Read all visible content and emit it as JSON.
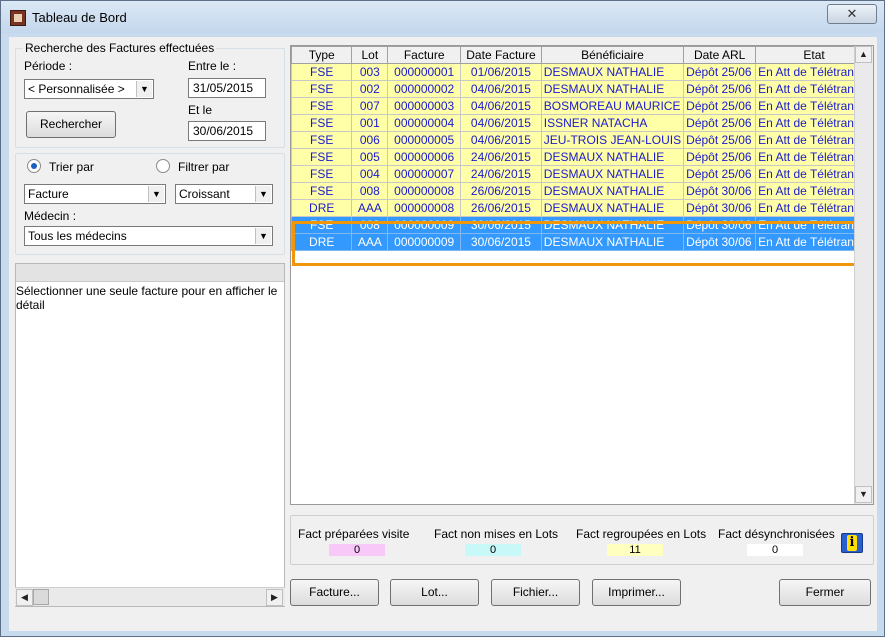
{
  "window": {
    "title": "Tableau de Bord",
    "close_glyph": "✕"
  },
  "search": {
    "group_title": "Recherche des Factures effectuées",
    "period_label": "Période :",
    "period_value": "< Personnalisée >",
    "from_label": "Entre le :",
    "from_value": "31/05/2015",
    "to_label": "Et le",
    "to_value": "30/06/2015",
    "search_button": "Rechercher"
  },
  "sort": {
    "sort_label": "Trier par",
    "filter_label": "Filtrer par",
    "sort_field": "Facture",
    "sort_order": "Croissant",
    "doctor_label": "Médecin :",
    "doctor_value": "Tous les médecins"
  },
  "detail": {
    "message": "Sélectionner une seule  facture pour en afficher le détail"
  },
  "grid": {
    "columns": [
      "Type",
      "Lot",
      "Facture",
      "Date Facture",
      "Bénéficiaire",
      "Date ARL",
      "Etat"
    ],
    "rows": [
      [
        "FSE",
        "003",
        "000000001",
        "01/06/2015",
        "DESMAUX NATHALIE",
        "Dépôt 25/06",
        "En Att de Télétransm"
      ],
      [
        "FSE",
        "002",
        "000000002",
        "04/06/2015",
        "DESMAUX NATHALIE",
        "Dépôt 25/06",
        "En Att de Télétransm"
      ],
      [
        "FSE",
        "007",
        "000000003",
        "04/06/2015",
        "BOSMOREAU MAURICE",
        "Dépôt 25/06",
        "En Att de Télétransm"
      ],
      [
        "FSE",
        "001",
        "000000004",
        "04/06/2015",
        "ISSNER NATACHA",
        "Dépôt 25/06",
        "En Att de Télétransm"
      ],
      [
        "FSE",
        "006",
        "000000005",
        "04/06/2015",
        "JEU-TROIS JEAN-LOUIS",
        "Dépôt 25/06",
        "En Att de Télétransm"
      ],
      [
        "FSE",
        "005",
        "000000006",
        "24/06/2015",
        "DESMAUX NATHALIE",
        "Dépôt 25/06",
        "En Att de Télétransm"
      ],
      [
        "FSE",
        "004",
        "000000007",
        "24/06/2015",
        "DESMAUX NATHALIE",
        "Dépôt 25/06",
        "En Att de Télétransm"
      ],
      [
        "FSE",
        "008",
        "000000008",
        "26/06/2015",
        "DESMAUX NATHALIE",
        "Dépôt 30/06",
        "En Att de Télétransm"
      ],
      [
        "DRE",
        "AAA",
        "000000008",
        "26/06/2015",
        "DESMAUX NATHALIE",
        "Dépôt 30/06",
        "En Att de Télétransm"
      ],
      [
        "FSE",
        "008",
        "000000009",
        "30/06/2015",
        "DESMAUX NATHALIE",
        "Dépôt 30/06",
        "En Att de Télétransm"
      ],
      [
        "DRE",
        "AAA",
        "000000009",
        "30/06/2015",
        "DESMAUX NATHALIE",
        "Dépôt 30/06",
        "En Att de Télétransm"
      ]
    ]
  },
  "stats": {
    "prepared_label": "Fact préparées visite",
    "prepared_value": "0",
    "unbatched_label": "Fact non mises en Lots",
    "unbatched_value": "0",
    "grouped_label": "Fact regroupées en Lots",
    "grouped_value": "11",
    "desync_label": "Fact désynchronisées",
    "desync_value": "0"
  },
  "buttons": {
    "facture": "Facture...",
    "lot": "Lot...",
    "fichier": "Fichier...",
    "imprimer": "Imprimer...",
    "fermer": "Fermer"
  },
  "colors": {
    "row_fill": "#ffffa8",
    "row_text": "#1a1ad0",
    "selected_fill": "#3399ff",
    "selection_outline": "#f0960a",
    "prepared_badge": "#f8c8f8",
    "unbatched_badge": "#c8f8f8",
    "grouped_badge": "#ffffc0",
    "desync_badge": "#ffffff"
  }
}
